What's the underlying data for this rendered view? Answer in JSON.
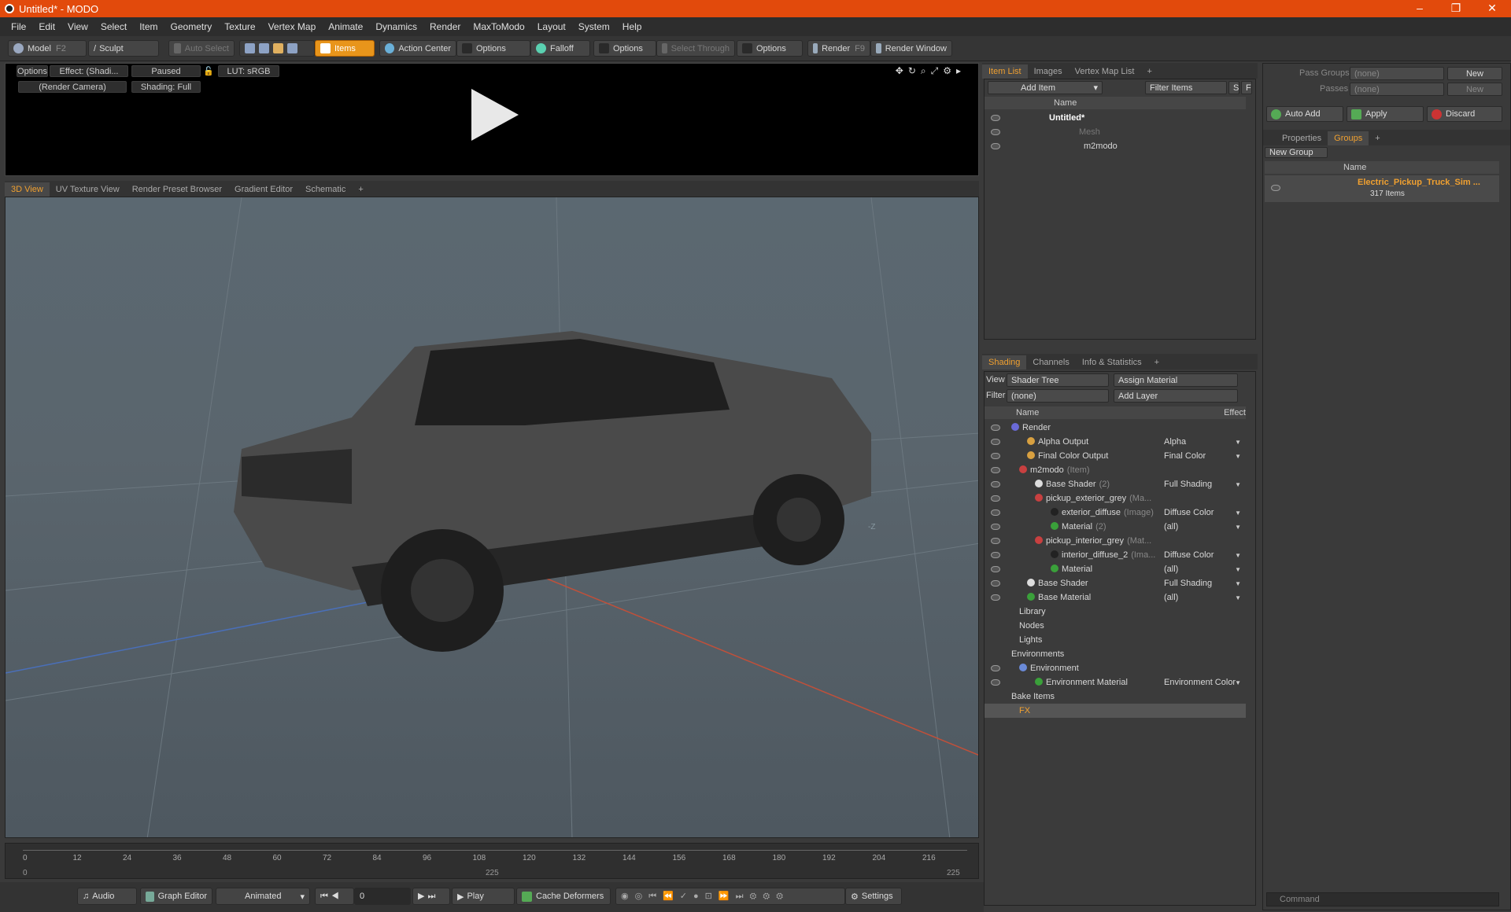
{
  "window": {
    "title": "Untitled* - MODO",
    "minimize": "–",
    "maximize": "❐",
    "close": "✕"
  },
  "menu": [
    "File",
    "Edit",
    "View",
    "Select",
    "Item",
    "Geometry",
    "Texture",
    "Vertex Map",
    "Animate",
    "Dynamics",
    "Render",
    "MaxToModo",
    "Layout",
    "System",
    "Help"
  ],
  "toolbar": {
    "model": "Model",
    "model_key": "F2",
    "sculpt": "Sculpt",
    "auto_select": "Auto Select",
    "items": "Items",
    "action_center": "Action Center",
    "options1": "Options",
    "falloff": "Falloff",
    "options2": "Options",
    "select_through": "Select Through",
    "options3": "Options",
    "render": "Render",
    "render_key": "F9",
    "render_window": "Render Window"
  },
  "preview": {
    "options": "Options",
    "effect": "Effect: (Shadi...",
    "paused": "Paused",
    "lut": "LUT: sRGB",
    "camera": "(Render Camera)",
    "shading": "Shading: Full"
  },
  "viewport_tabs": [
    "3D View",
    "UV Texture View",
    "Render Preset Browser",
    "Gradient Editor",
    "Schematic"
  ],
  "viewport": {
    "axis_label": "-Z"
  },
  "timeline": {
    "ticks": [
      "0",
      "12",
      "24",
      "36",
      "48",
      "60",
      "72",
      "84",
      "96",
      "108",
      "120",
      "132",
      "144",
      "156",
      "168",
      "180",
      "192",
      "204",
      "216"
    ],
    "start": "0",
    "mid": "225",
    "end": "225"
  },
  "bottom": {
    "audio": "Audio",
    "graph_editor": "Graph Editor",
    "animated": "Animated",
    "frame": "0",
    "play": "Play",
    "cache_deformers": "Cache Deformers",
    "settings": "Settings"
  },
  "item_list": {
    "tabs": [
      "Item List",
      "Images",
      "Vertex Map List"
    ],
    "add_item": "Add Item",
    "filter_items": "Filter Items",
    "s": "S",
    "f": "F",
    "col_name": "Name",
    "rows": [
      {
        "label": "Untitled*"
      },
      {
        "label": "Mesh"
      },
      {
        "label": "m2modo"
      }
    ]
  },
  "shading": {
    "tabs": [
      "Shading",
      "Channels",
      "Info & Statistics"
    ],
    "view_label": "View",
    "view_value": "Shader Tree",
    "assign_material": "Assign Material",
    "filter_label": "Filter",
    "filter_value": "(none)",
    "add_layer": "Add Layer",
    "col_name": "Name",
    "col_effect": "Effect",
    "rows": [
      {
        "label": "Render",
        "suffix": "",
        "effect": "",
        "color": "#6a6ad8"
      },
      {
        "label": "Alpha Output",
        "suffix": "",
        "effect": "Alpha",
        "color": "#d8a040"
      },
      {
        "label": "Final Color Output",
        "suffix": "",
        "effect": "Final Color",
        "color": "#d8a040"
      },
      {
        "label": "m2modo",
        "suffix": "(Item)",
        "effect": "",
        "color": "#c84040"
      },
      {
        "label": "Base Shader",
        "suffix": "(2)",
        "effect": "Full Shading",
        "color": "#dddddd"
      },
      {
        "label": "pickup_exterior_grey",
        "suffix": "(Ma...",
        "effect": "",
        "color": "#c84040"
      },
      {
        "label": "exterior_diffuse",
        "suffix": "(Image)",
        "effect": "Diffuse Color",
        "color": "#222222"
      },
      {
        "label": "Material",
        "suffix": "(2)",
        "effect": "(all)",
        "color": "#3aa03a"
      },
      {
        "label": "pickup_interior_grey",
        "suffix": "(Mat...",
        "effect": "",
        "color": "#c84040"
      },
      {
        "label": "interior_diffuse_2",
        "suffix": "(Ima...",
        "effect": "Diffuse Color",
        "color": "#222222"
      },
      {
        "label": "Material",
        "suffix": "",
        "effect": "(all)",
        "color": "#3aa03a"
      },
      {
        "label": "Base Shader",
        "suffix": "",
        "effect": "Full Shading",
        "color": "#dddddd"
      },
      {
        "label": "Base Material",
        "suffix": "",
        "effect": "(all)",
        "color": "#3aa03a"
      },
      {
        "label": "Library",
        "suffix": "",
        "effect": "",
        "color": ""
      },
      {
        "label": "Nodes",
        "suffix": "",
        "effect": "",
        "color": ""
      },
      {
        "label": "Lights",
        "suffix": "",
        "effect": "",
        "color": ""
      },
      {
        "label": "Environments",
        "suffix": "",
        "effect": "",
        "color": ""
      },
      {
        "label": "Environment",
        "suffix": "",
        "effect": "",
        "color": "#6a8ad8"
      },
      {
        "label": "Environment Material",
        "suffix": "",
        "effect": "Environment Color",
        "color": "#3aa03a"
      },
      {
        "label": "Bake Items",
        "suffix": "",
        "effect": "",
        "color": ""
      },
      {
        "label": "FX",
        "suffix": "",
        "effect": "",
        "color": ""
      }
    ]
  },
  "groups": {
    "pass_groups_label": "Pass Groups",
    "pass_groups_value": "(none)",
    "new1": "New",
    "passes_label": "Passes",
    "passes_value": "(none)",
    "new2": "New",
    "auto_add": "Auto Add",
    "apply": "Apply",
    "discard": "Discard",
    "tabs": [
      "Properties",
      "Groups"
    ],
    "new_group": "New Group",
    "col_name": "Name",
    "group_name": "Electric_Pickup_Truck_Sim ...",
    "group_count": "317 Items",
    "command_placeholder": "Command"
  }
}
